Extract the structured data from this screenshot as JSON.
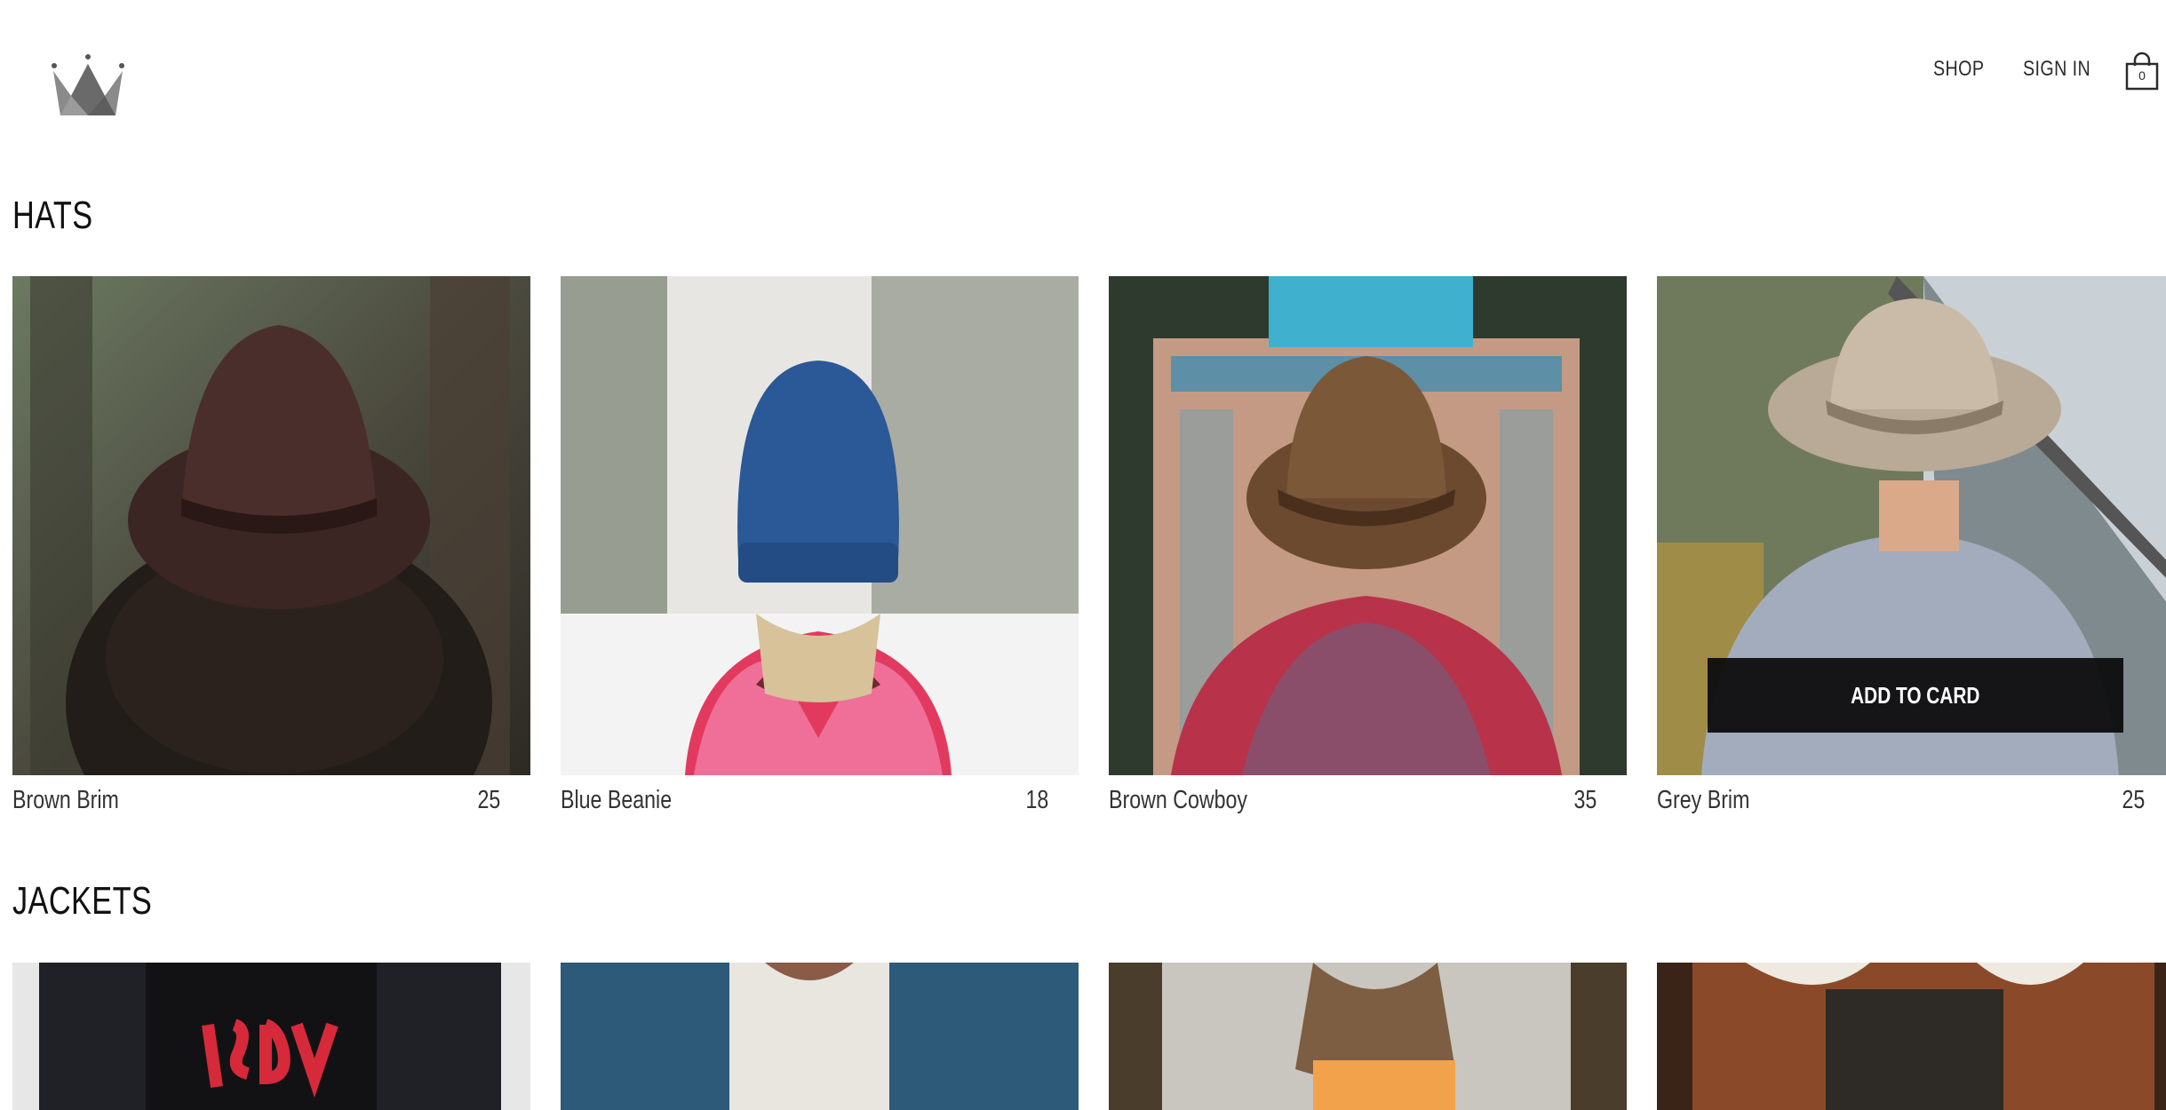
{
  "header": {
    "logo_icon": "crown-icon",
    "nav": {
      "shop_label": "SHOP",
      "signin_label": "SIGN IN"
    },
    "cart": {
      "icon": "shopping-bag-icon",
      "count": "0"
    }
  },
  "sections": [
    {
      "title": "HATS",
      "items": [
        {
          "name": "Brown Brim",
          "price": "25"
        },
        {
          "name": "Blue Beanie",
          "price": "18"
        },
        {
          "name": "Brown Cowboy",
          "price": "35"
        },
        {
          "name": "Grey Brim",
          "price": "25",
          "hover_button": "ADD TO CARD"
        }
      ]
    },
    {
      "title": "JACKETS",
      "items": [
        {
          "image": "black-denim-jacket-photo"
        },
        {
          "image": "blue-denim-jacket-photo"
        },
        {
          "image": "light-denim-jacket-photo"
        },
        {
          "image": "brown-shearling-jacket-photo"
        }
      ]
    }
  ],
  "colors": {
    "button_bg": "#0c0c0e",
    "text": "#222222",
    "background": "#ffffff"
  }
}
